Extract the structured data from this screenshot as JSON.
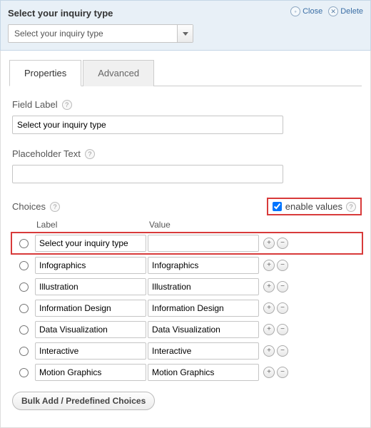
{
  "header": {
    "title": "Select your inquiry type",
    "close_label": "Close",
    "delete_label": "Delete",
    "dropdown_preview": "Select your inquiry type"
  },
  "tabs": {
    "properties": "Properties",
    "advanced": "Advanced"
  },
  "fields": {
    "field_label_text": "Field Label",
    "field_label_value": "Select your inquiry type",
    "placeholder_label": "Placeholder Text",
    "placeholder_value": ""
  },
  "choices_section": {
    "label": "Choices",
    "enable_values_label": "enable values",
    "enable_values_checked": true,
    "col_label": "Label",
    "col_value": "Value",
    "bulk_button": "Bulk Add / Predefined Choices",
    "rows": [
      {
        "label": "Select your inquiry type",
        "value": "",
        "highlight": true
      },
      {
        "label": "Infographics",
        "value": "Infographics",
        "highlight": false
      },
      {
        "label": "Illustration",
        "value": "Illustration",
        "highlight": false
      },
      {
        "label": "Information Design",
        "value": "Information Design",
        "highlight": false
      },
      {
        "label": "Data Visualization",
        "value": "Data Visualization",
        "highlight": false
      },
      {
        "label": "Interactive",
        "value": "Interactive",
        "highlight": false
      },
      {
        "label": "Motion Graphics",
        "value": "Motion Graphics",
        "highlight": false
      }
    ]
  }
}
